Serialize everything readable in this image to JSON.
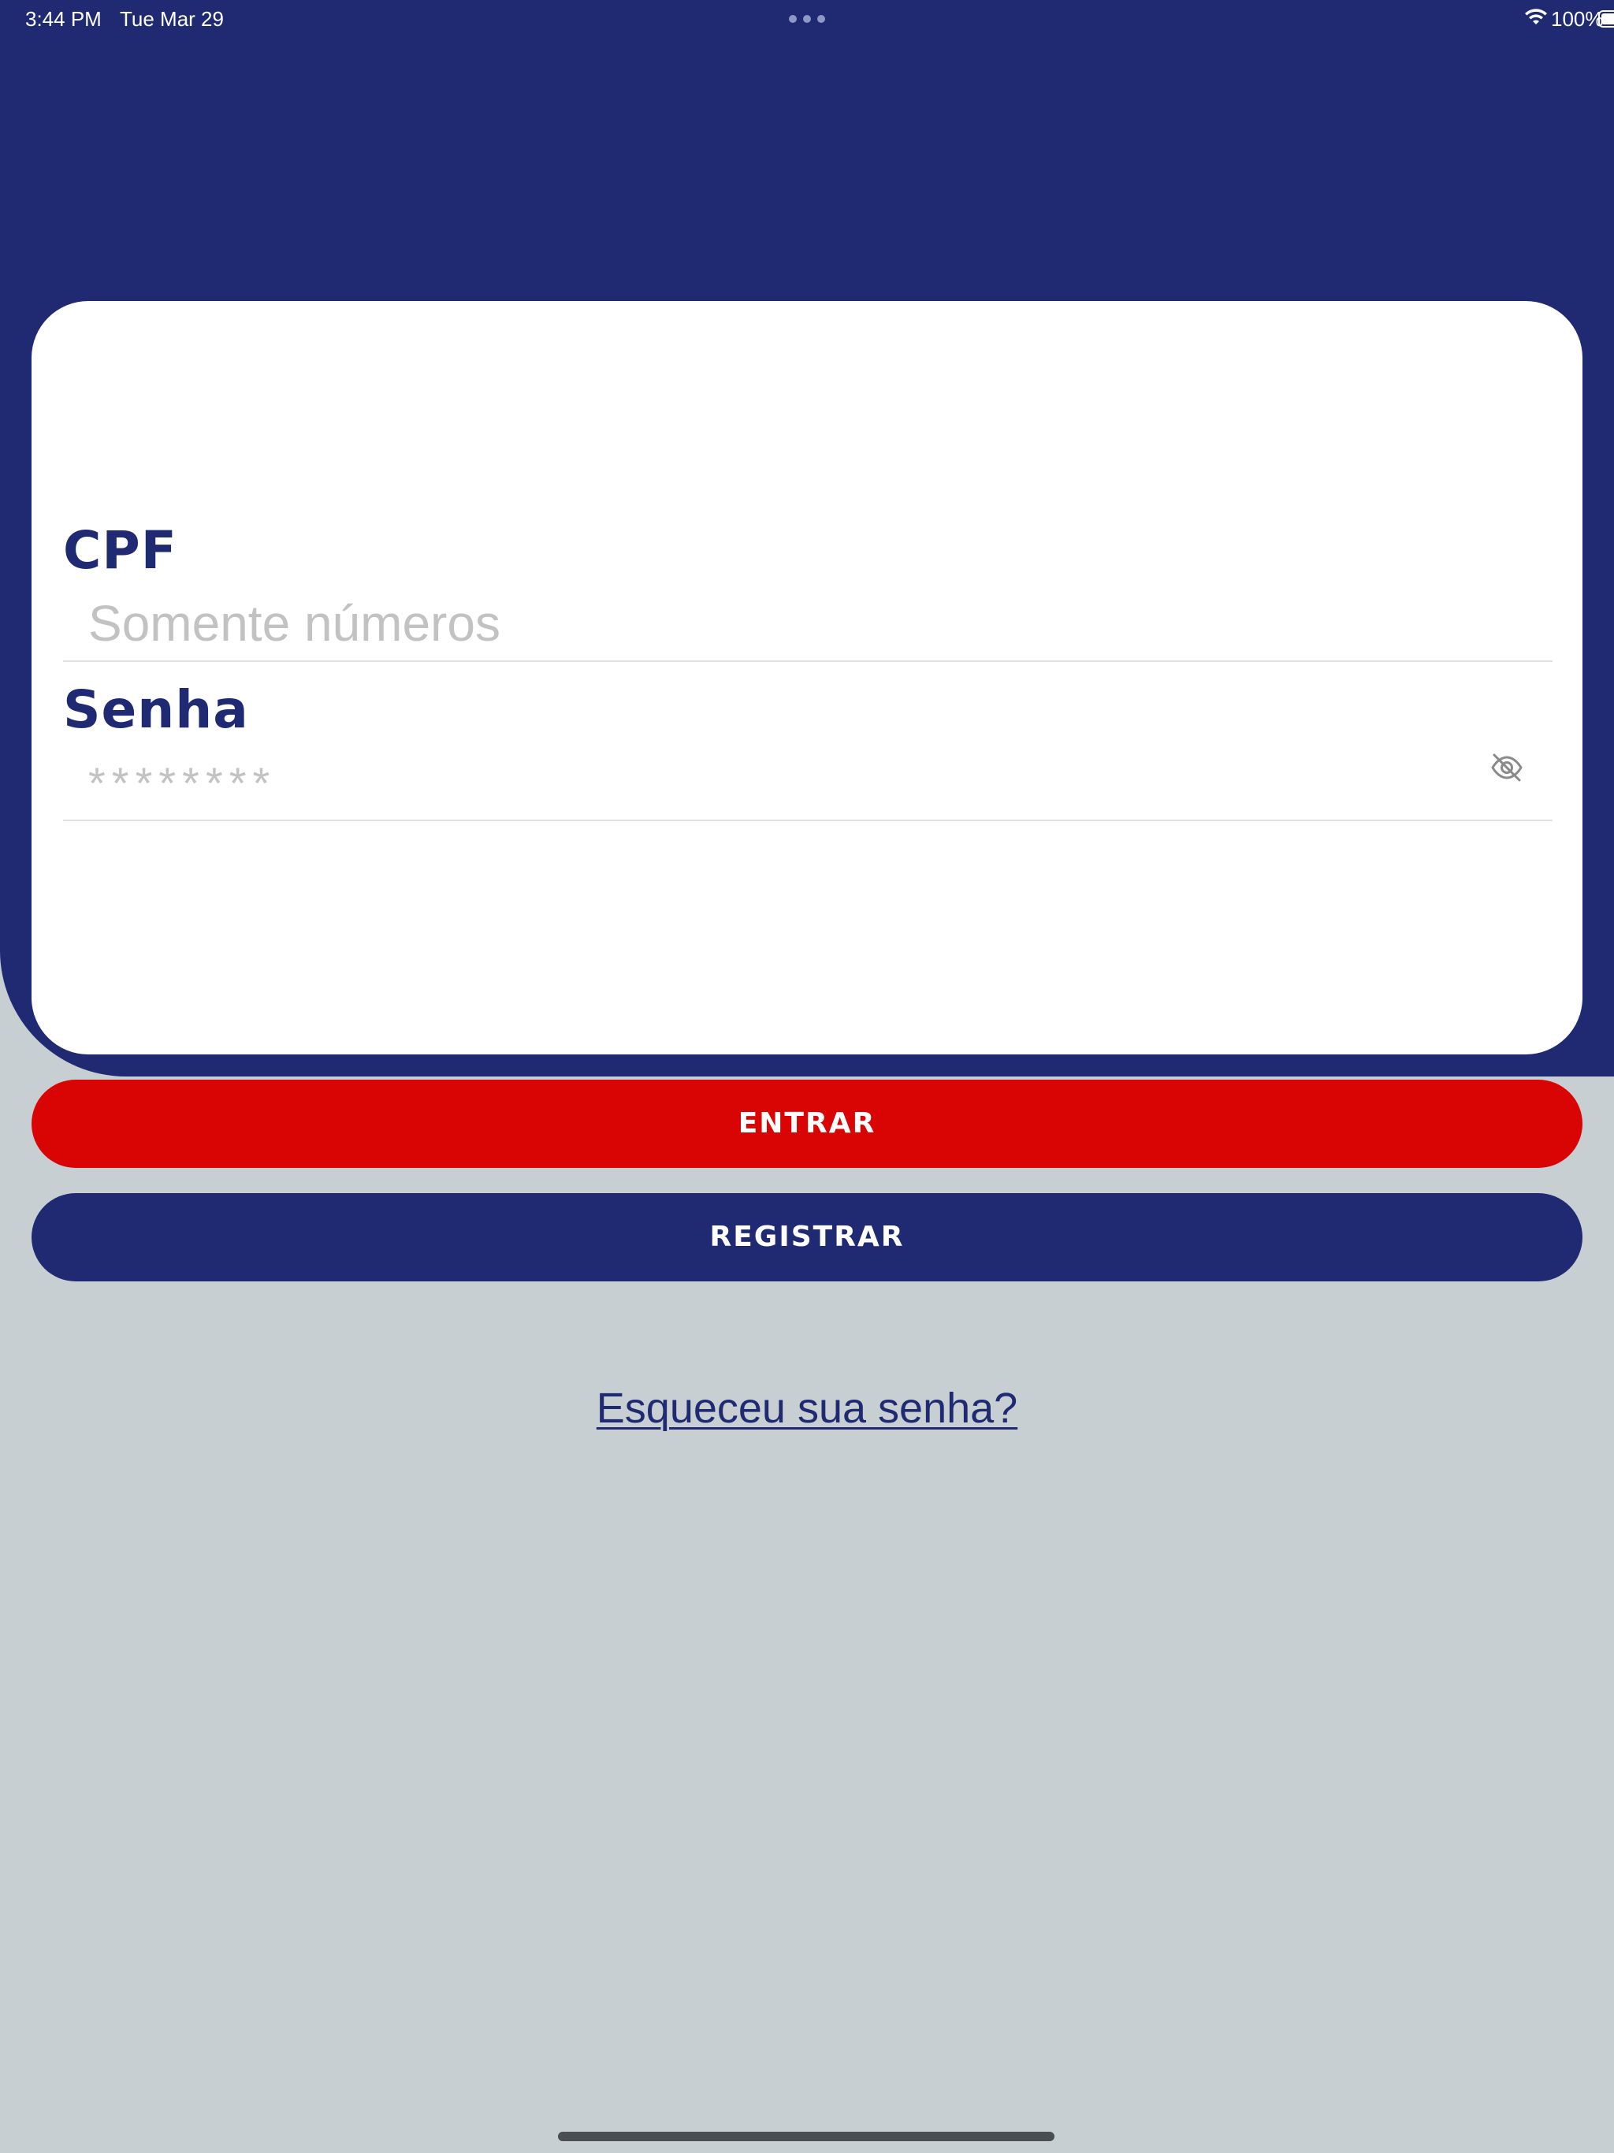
{
  "status_bar": {
    "time": "3:44 PM",
    "date": "Tue Mar 29",
    "battery": "100%",
    "wifi_icon": "wifi-icon",
    "battery_icon": "battery-icon",
    "multitasking_icon": "more-dots-icon"
  },
  "form": {
    "cpf_label": "CPF",
    "cpf_placeholder": "Somente números",
    "cpf_value": "",
    "senha_label": "Senha",
    "senha_placeholder": "********",
    "senha_value": "",
    "visibility_icon": "eye-off-icon"
  },
  "actions": {
    "entrar_label": "ENTRAR",
    "registrar_label": "REGISTRAR",
    "forgot_label": "Esqueceu sua senha?"
  },
  "colors": {
    "brand_navy": "#1f2a72",
    "primary_red": "#d90404",
    "background": "#c7cfd2",
    "card": "#ffffff",
    "placeholder": "#c2c2c2"
  }
}
